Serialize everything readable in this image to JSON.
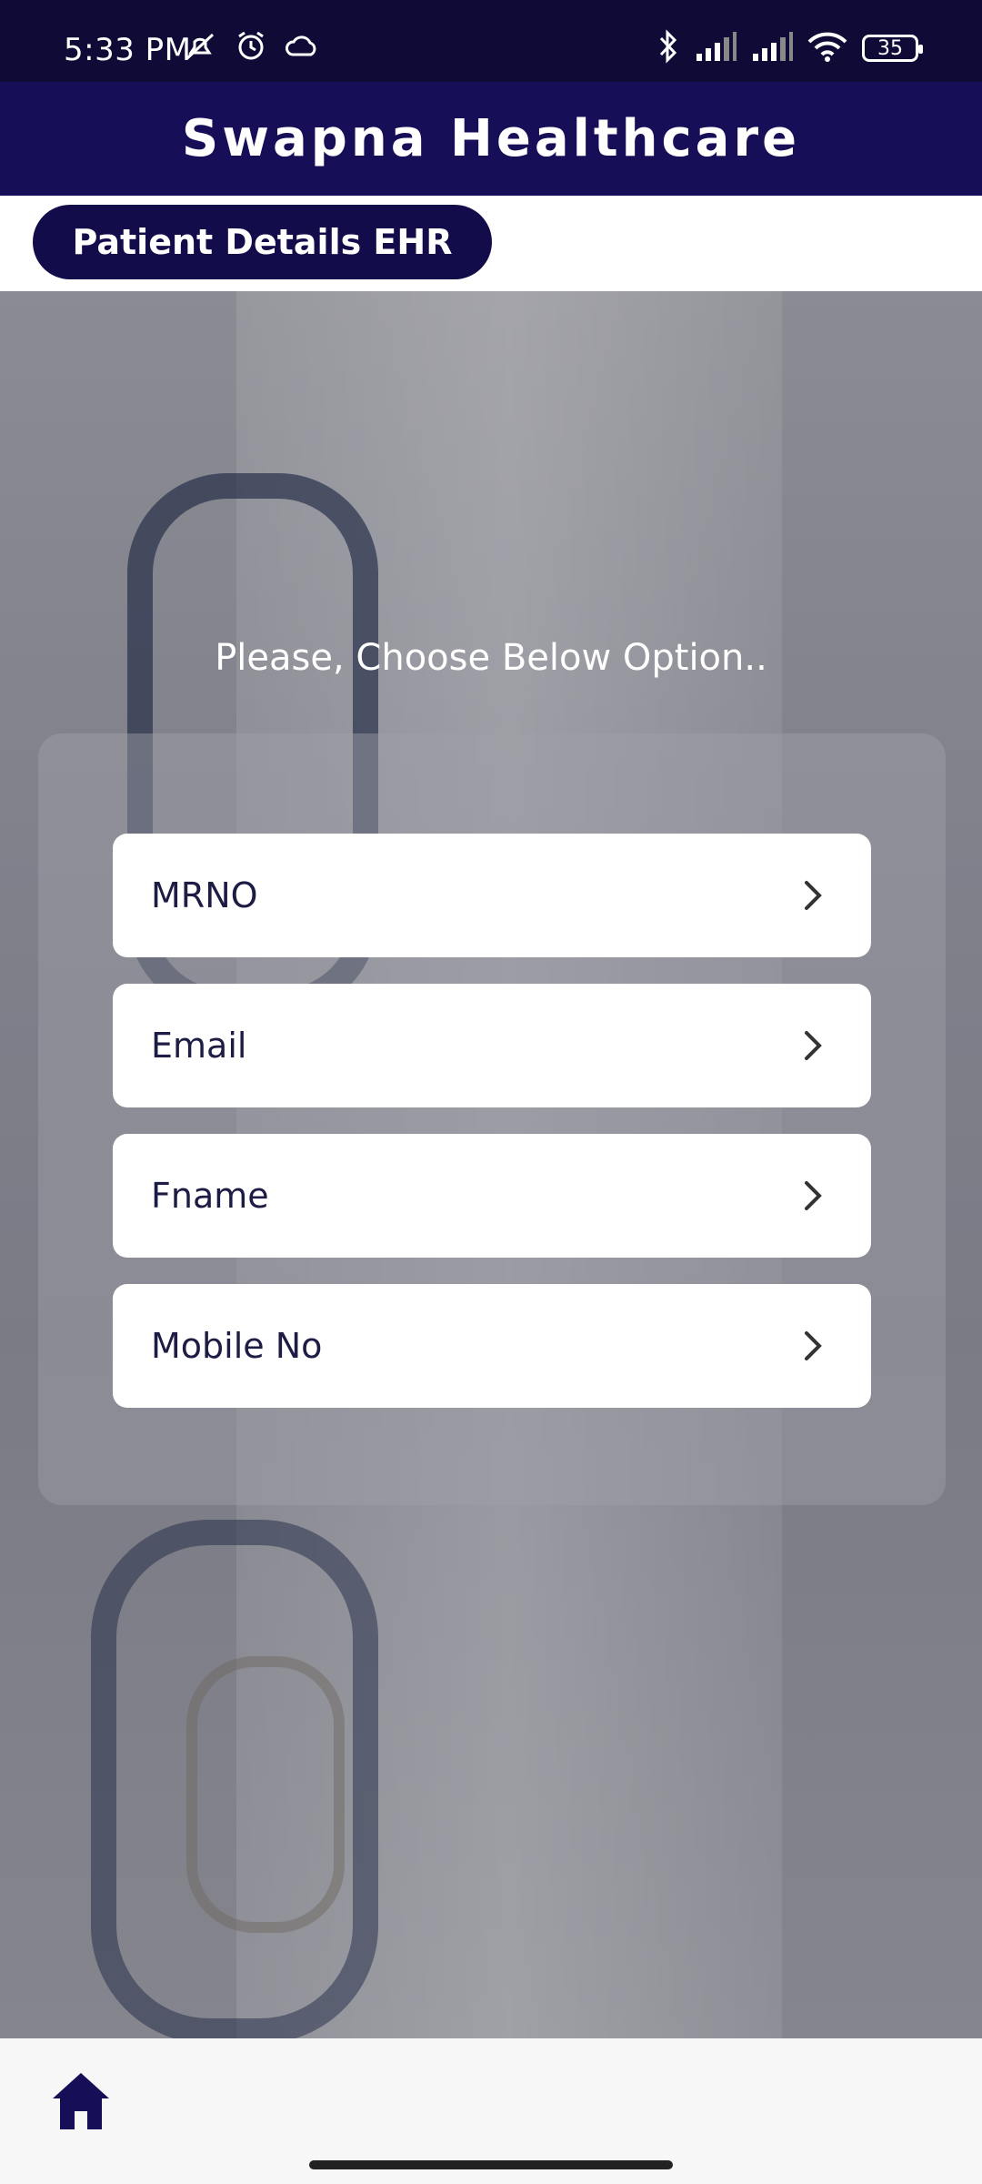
{
  "status_bar": {
    "time": "5:33 PM",
    "battery": "35",
    "icons": [
      "mute-icon",
      "alarm-icon",
      "cloud-icon",
      "bluetooth-icon",
      "signal-icon",
      "signal-icon",
      "wifi-icon",
      "battery-icon"
    ]
  },
  "header": {
    "title": "Swapna Healthcare"
  },
  "subheader": {
    "pill_label": "Patient Details EHR"
  },
  "main": {
    "prompt": "Please, Choose Below Option..",
    "options": [
      {
        "label": "MRNO"
      },
      {
        "label": "Email"
      },
      {
        "label": "Fname"
      },
      {
        "label": "Mobile No"
      }
    ]
  },
  "bottom_nav": {
    "items": [
      {
        "icon": "home-icon"
      }
    ]
  },
  "colors": {
    "primary": "#170e58",
    "status_bar": "#0f0a36",
    "text_dark": "#1d1c44"
  }
}
